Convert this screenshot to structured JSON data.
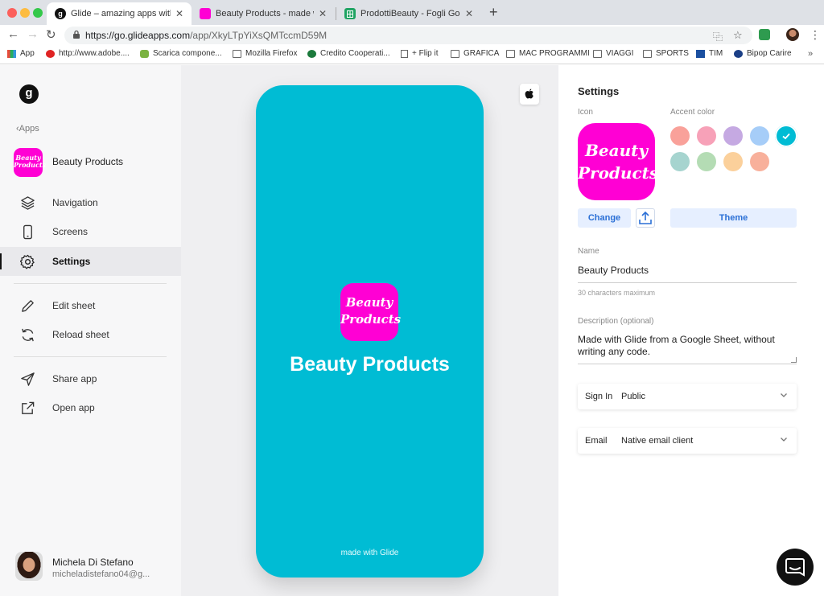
{
  "browser": {
    "tabs": [
      {
        "title": "Glide – amazing apps without c",
        "favicon": "glide-favicon",
        "active": true
      },
      {
        "title": "Beauty Products - made with G",
        "favicon": "beauty-favicon",
        "active": false
      },
      {
        "title": "ProdottiBeauty - Fogli Google",
        "favicon": "sheets-favicon",
        "active": false
      }
    ],
    "url_host": "https://go.glideapps.com",
    "url_path": "/app/XkyLTpYiXsQMTccmD59M",
    "bookmarks": [
      "App",
      "http://www.adobe....",
      "Scarica compone...",
      "Mozilla Firefox",
      "Credito Cooperati...",
      "+ Flip it",
      "GRAFICA",
      "MAC PROGRAMMI",
      "VIAGGI",
      "SPORTS",
      "TIM",
      "Bipop Carire"
    ],
    "bookmarks_more": "»"
  },
  "sidebar": {
    "logo_letter": "g",
    "apps_link": "Apps",
    "app": {
      "name": "Beauty Products",
      "logo_text": "Beauty Products"
    },
    "items": [
      {
        "label": "Navigation",
        "icon": "layers-icon"
      },
      {
        "label": "Screens",
        "icon": "phone-icon"
      },
      {
        "label": "Settings",
        "icon": "gear-icon",
        "active": true
      },
      {
        "label": "Edit sheet",
        "icon": "pencil-icon"
      },
      {
        "label": "Reload sheet",
        "icon": "reload-icon"
      },
      {
        "label": "Share app",
        "icon": "send-icon"
      },
      {
        "label": "Open app",
        "icon": "external-link-icon"
      }
    ],
    "user": {
      "name": "Michela Di Stefano",
      "email": "micheladistefano04@g..."
    }
  },
  "preview": {
    "logo_text": "Beauty Products",
    "title": "Beauty Products",
    "footer": "made with Glide",
    "platform_icon": "apple-icon",
    "bg_color": "#00bcd4"
  },
  "settings": {
    "title": "Settings",
    "icon_label": "Icon",
    "accent_label": "Accent color",
    "icon_text": "Beauty Products",
    "accent_colors": [
      "#f9a19a",
      "#f7a1b8",
      "#c5a9e2",
      "#a6cdf8",
      "#00bcd4",
      "#a6d4cf",
      "#b4dcb4",
      "#fbd09b",
      "#f8b09b"
    ],
    "selected_accent": "#00bcd4",
    "change_label": "Change",
    "theme_label": "Theme",
    "name_label": "Name",
    "name_value": "Beauty Products",
    "name_hint": "30 characters maximum",
    "description_label": "Description (optional)",
    "description_value": "Made with Glide from a Google Sheet, without writing any code.",
    "sign_in_label": "Sign In",
    "sign_in_value": "Public",
    "email_label": "Email",
    "email_value": "Native email client"
  }
}
